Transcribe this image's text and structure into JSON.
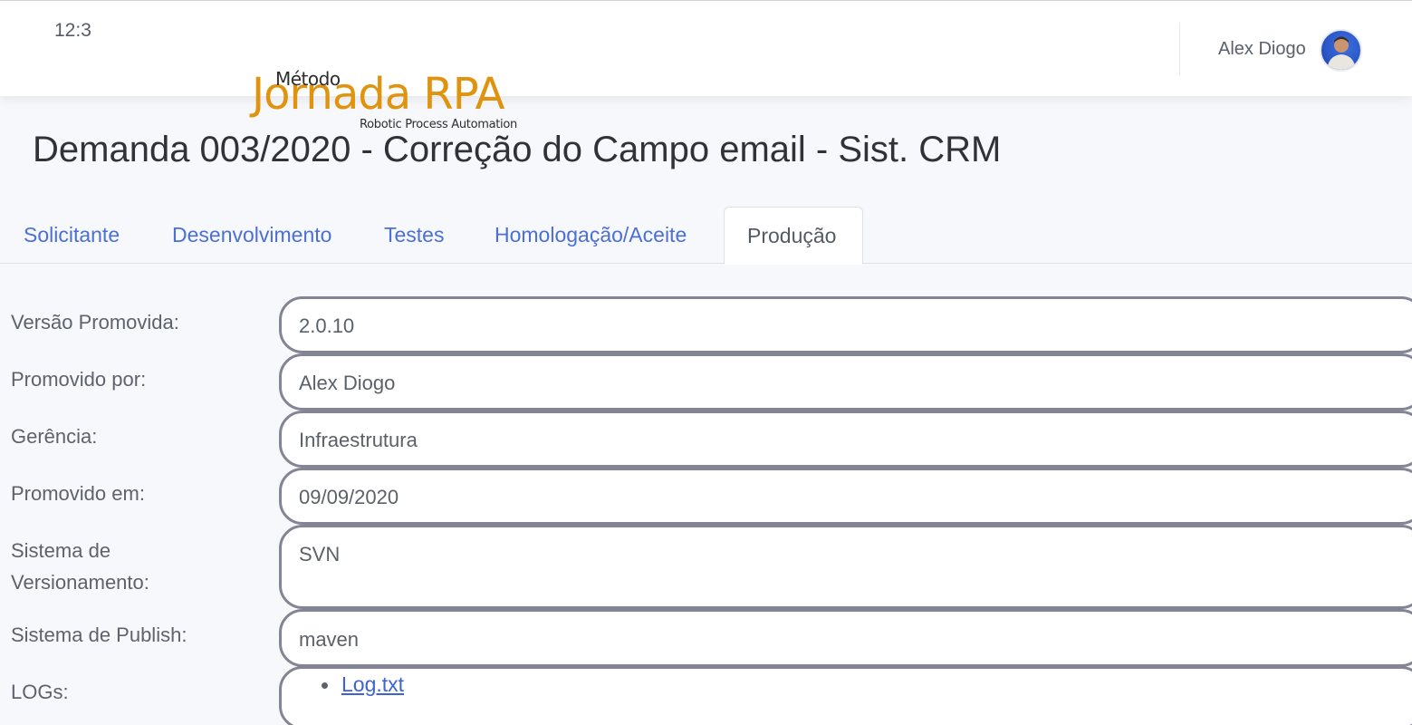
{
  "header": {
    "clock": "12:3",
    "user_name": "Alex Diogo"
  },
  "logo": {
    "top": "Método",
    "main": "Jornada RPA",
    "subtitle": "Robotic Process Automation"
  },
  "page_title": "Demanda 003/2020 - Correção do Campo email - Sist. CRM",
  "tabs": [
    {
      "label": "Solicitante",
      "active": false
    },
    {
      "label": "Desenvolvimento",
      "active": false
    },
    {
      "label": "Testes",
      "active": false
    },
    {
      "label": "Homologação/Aceite",
      "active": false
    },
    {
      "label": "Produção",
      "active": true
    }
  ],
  "form": {
    "versao": {
      "label": "Versão Promovida:",
      "value": "2.0.10"
    },
    "promovido_por": {
      "label": "Promovido por:",
      "value": "Alex Diogo"
    },
    "gerencia": {
      "label": "Gerência:",
      "value": "Infraestrutura"
    },
    "promovido_em": {
      "label": "Promovido em:",
      "value": "09/09/2020"
    },
    "sistema_versionamento": {
      "label_line1": "Sistema de",
      "label_line2": "Versionamento:",
      "value": "SVN"
    },
    "sistema_publish": {
      "label": "Sistema de Publish:",
      "value": "maven"
    },
    "logs": {
      "label": "LOGs:",
      "items": [
        "Log.txt"
      ]
    }
  },
  "colors": {
    "accent_link": "#4b6fd6",
    "logo_orange": "#e0930e",
    "field_border": "#838595",
    "page_bg": "#f7f8fb"
  },
  "icons": {
    "avatar": "user-avatar-photo"
  }
}
